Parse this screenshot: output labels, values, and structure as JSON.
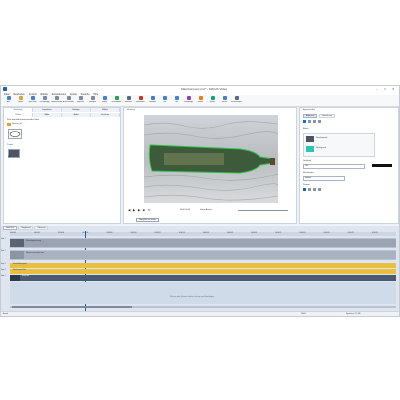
{
  "window": {
    "title": "Flaschenpost.mxc* - MAGIX Video",
    "minimize": "–",
    "maximize": "□",
    "close": "✕",
    "app_icon": "app-logo-icon"
  },
  "menu": [
    "Datei",
    "Bearbeiten",
    "Ansicht",
    "Effekte",
    "Einstellungen",
    "Extras",
    "Sprache",
    "Hilfe"
  ],
  "ribbon": {
    "groups": [
      {
        "label": "Neu",
        "color": "#4a7fc1"
      },
      {
        "label": "Öffnen",
        "color": "#e2a23b"
      },
      {
        "label": "Speichern",
        "color": "#4a7fc1"
      },
      {
        "label": "Rückgängig",
        "color": "#7a8aa0"
      },
      {
        "label": "Wiederherstellen",
        "color": "#7a8aa0"
      },
      {
        "label": "Ausschneiden",
        "color": "#7a8aa0"
      },
      {
        "label": "Kopieren",
        "color": "#7a8aa0"
      },
      {
        "label": "Einfügen",
        "color": "#7a8aa0"
      },
      {
        "label": "Export",
        "color": "#4a7fc1"
      },
      {
        "label": "Wiedergabe",
        "color": "#2ea24a"
      },
      {
        "label": "Auswahl",
        "color": "#5b6b80"
      },
      {
        "label": "Aufnahme",
        "color": "#c0392b"
      },
      {
        "label": "Vorlagen",
        "color": "#4a7fc1"
      },
      {
        "label": "Text",
        "color": "#4a7fc1"
      },
      {
        "label": "Titel",
        "color": "#4a7fc1"
      },
      {
        "label": "Übergänge",
        "color": "#8e44ad"
      },
      {
        "label": "Effekte",
        "color": "#e67e22"
      },
      {
        "label": "Audio",
        "color": "#16a085"
      },
      {
        "label": "Menüs",
        "color": "#4a7fc1"
      },
      {
        "label": "Einstellungen",
        "color": "#5b6b80"
      }
    ]
  },
  "left_panel": {
    "tabs_top": [
      "Mediathek",
      "Importieren",
      "Vorlagen",
      "Effekte"
    ],
    "tabs_second": [
      "Videos",
      "Bilder",
      "Audio",
      "Vorschau"
    ],
    "path_label": "Pfad: dein-bild-desktop-mozilla-Ordner",
    "item_label": "Flasche_00",
    "section": "Projekt",
    "thumb_label": "Bild",
    "folder_icon": "folder-icon"
  },
  "preview": {
    "header": "Vorschau",
    "time": "00:00:00:00",
    "tooltip": "Übergabe an Viewer",
    "controls": [
      "prev-frame-icon",
      "play-icon",
      "next-frame-icon",
      "stop-icon",
      "loop-icon"
    ],
    "zoom": "Ganze Ansicht"
  },
  "properties": {
    "header": "Eigenschaften",
    "tabs": [
      "Allgemein",
      "Maskierung"
    ],
    "section_label": "Ebene",
    "layer1_name": "Flaschenpost",
    "layer2_name": "Hintergrund",
    "value_label": "Deckkraft",
    "value": "100",
    "position_label": "Position",
    "blend_label": "Mischmodus",
    "blend_value": "Normal",
    "color_swatch": "#0078d4",
    "accent": "#2ec4b6"
  },
  "timeline": {
    "tabs": [
      "Zeitachse",
      "Storyboard",
      "Übersicht"
    ],
    "ruler": [
      "00:00:00",
      "00:00:02",
      "00:00:04",
      "00:00:06",
      "00:00:08",
      "00:00:10",
      "00:00:12",
      "00:00:14",
      "00:00:16",
      "00:00:18",
      "00:00:20",
      "00:00:22",
      "00:00:24",
      "00:00:26",
      "00:00:28",
      "00:00:30"
    ],
    "tracks": [
      {
        "label": "Spur 1",
        "clip": "Flaschenpost.png",
        "color": "#5b6474"
      },
      {
        "label": "Spur 2",
        "clip": "Meeresrauschen.wav",
        "color": "#8b95a5"
      },
      {
        "label": "Spur 3",
        "clip": "Strand-Hintergrund",
        "color": "#e8bf3f"
      },
      {
        "label": "Spur 4",
        "clip": "Flaschenpost-Titel",
        "color": "#e8bf3f"
      },
      {
        "label": "Spur 5",
        "clip": "Audio-Mix",
        "color": "#4a5a70"
      }
    ],
    "drop_hint": "Klicken oder Dateien hierher ziehen zum Hinzufügen"
  },
  "status": {
    "left": "Bereit",
    "right": "Speicher: 2.1 GB",
    "zoom": "100%"
  }
}
